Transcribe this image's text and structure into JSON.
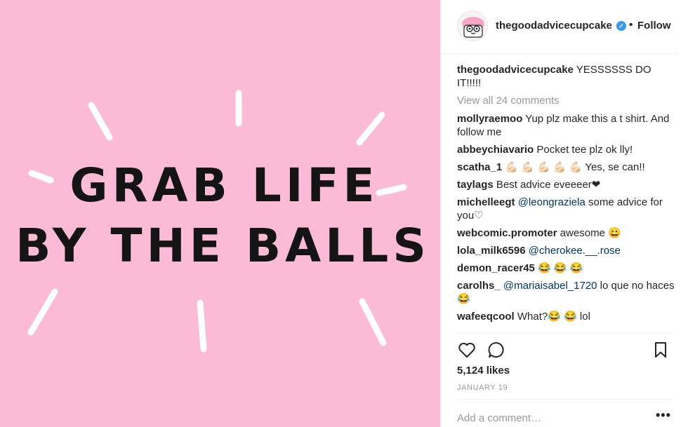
{
  "image": {
    "line1": "GRAB LIFE",
    "line2": "BY THE BALLS",
    "background": "#fbbad5"
  },
  "header": {
    "username": "thegoodadvicecupcake",
    "separator": "•",
    "follow_label": "Follow"
  },
  "caption": {
    "username": "thegoodadvicecupcake",
    "text": "YESSSSSS DO IT!!!!!"
  },
  "view_all_label": "View all 24 comments",
  "comments": [
    {
      "user": "mollyraemoo",
      "text": "Yup plz make this a t shirt. And follow me"
    },
    {
      "user": "abbeychiavario",
      "text": "Pocket tee plz ok lly!"
    },
    {
      "user": "scatha_1",
      "text": "💪🏻 💪🏻 💪🏻 💪🏻 💪🏻 Yes, se can!!"
    },
    {
      "user": "taylags",
      "text": "Best advice eveeeer❤"
    },
    {
      "user": "michelleegt",
      "mention": "@leongraziela",
      "text": " some advice for you♡"
    },
    {
      "user": "webcomic.promoter",
      "text": "awesome 😀"
    },
    {
      "user": "lola_milk6596",
      "mention": "@cherokee.__.rose",
      "text": ""
    },
    {
      "user": "demon_racer45",
      "text": "😂 😂 😂"
    },
    {
      "user": "carolhs_",
      "mention": "@mariaisabel_1720",
      "text": " lo que no haces😂"
    },
    {
      "user": "wafeeqcool",
      "text": "What?😂 😂 lol"
    }
  ],
  "icons": [
    "heart-icon",
    "comment-icon",
    "bookmark-icon"
  ],
  "likes": "5,124 likes",
  "date": "JANUARY 19",
  "add_comment_placeholder": "Add a comment…",
  "more_label": "•••",
  "colors": {
    "accent": "#3897f0",
    "mention": "#003569",
    "muted": "#999999"
  }
}
